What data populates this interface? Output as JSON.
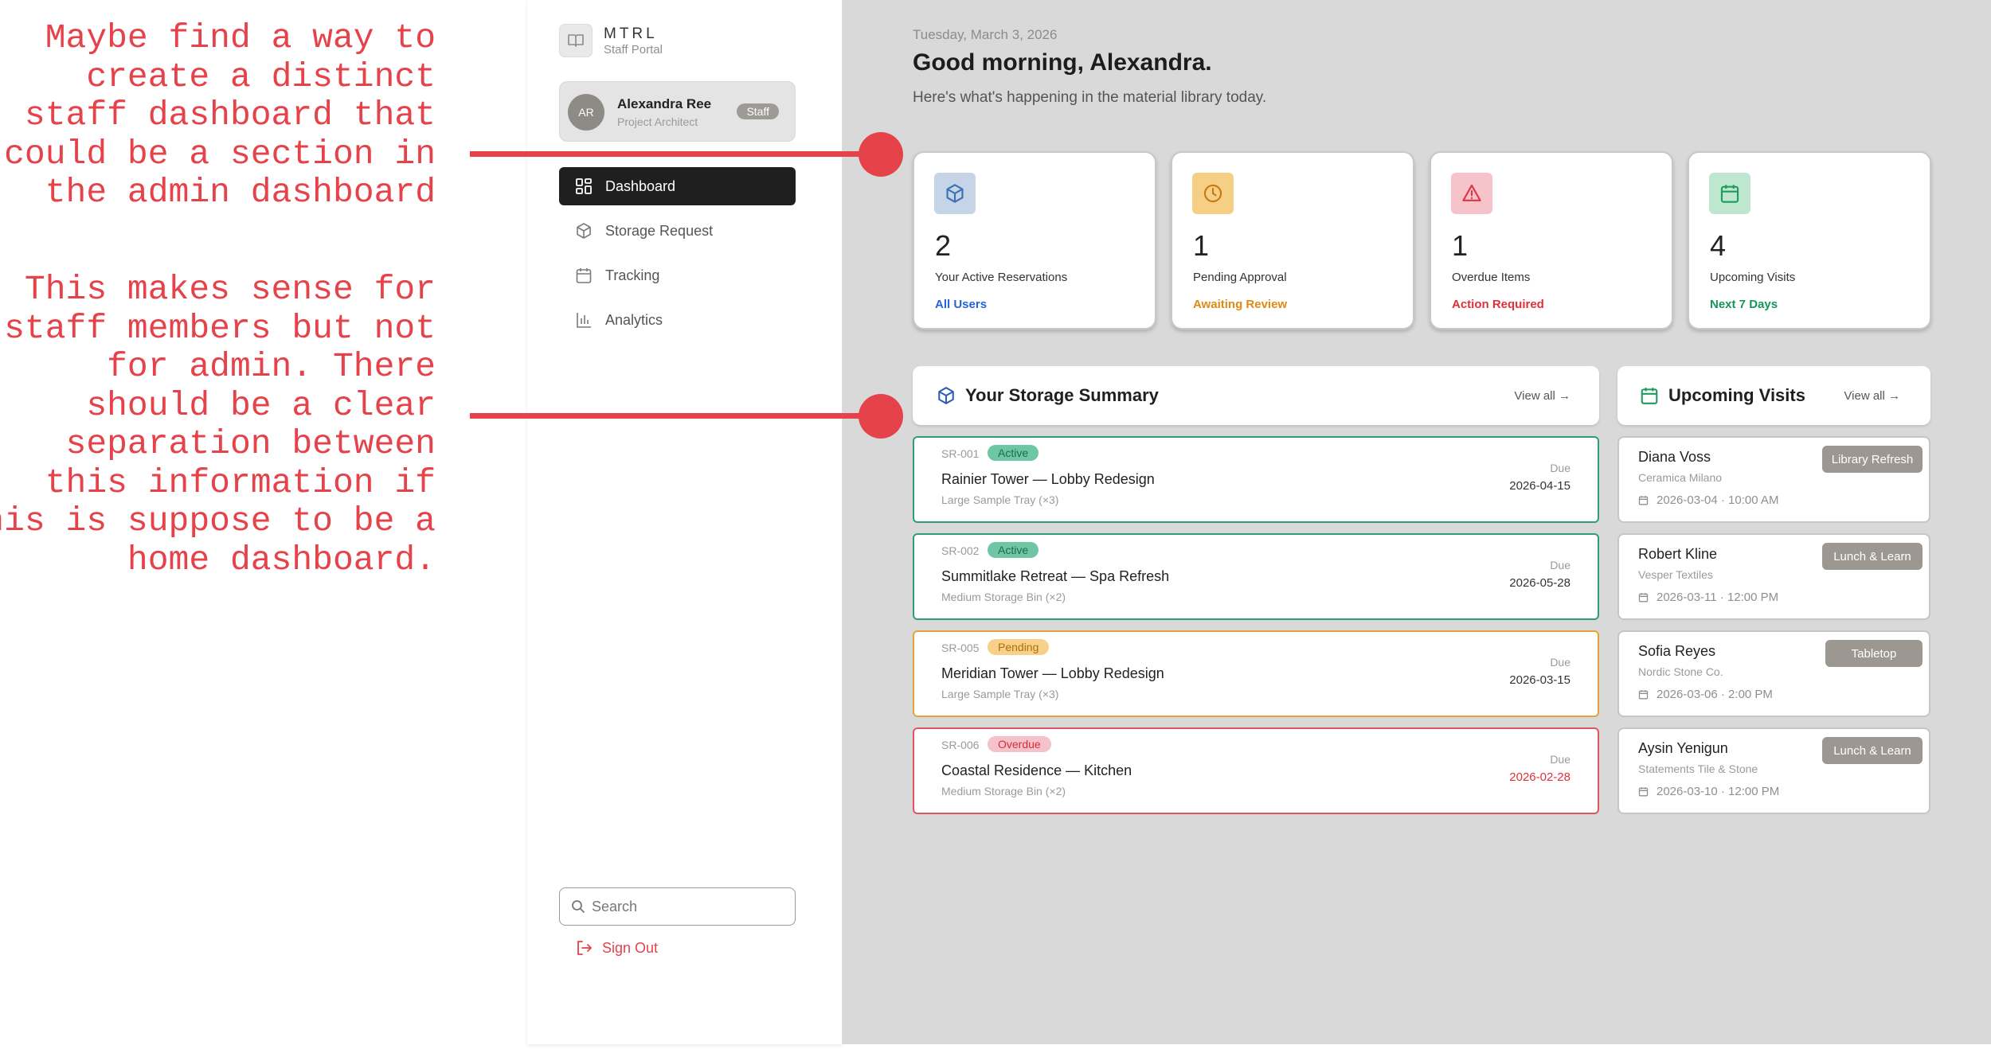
{
  "annotations": [
    {
      "lines": [
        "Maybe find a way to",
        "create a distinct",
        "staff dashboard that",
        "could be a section in",
        "the admin dashboard"
      ]
    },
    {
      "lines": [
        "This makes sense for",
        "staff members but not",
        "for admin. There",
        "should be a clear",
        "separation between",
        "this information if",
        "his is suppose to be a",
        "home dashboard."
      ]
    }
  ],
  "app": {
    "name": "MTRL",
    "subtitle": "Staff Portal"
  },
  "user": {
    "initials": "AR",
    "name": "Alexandra Ree",
    "role": "Project Architect",
    "badge": "Staff"
  },
  "nav": [
    {
      "label": "Dashboard",
      "icon": "grid-icon",
      "active": true
    },
    {
      "label": "Storage Request",
      "icon": "box-icon",
      "active": false
    },
    {
      "label": "Tracking",
      "icon": "calendar-icon",
      "active": false
    },
    {
      "label": "Analytics",
      "icon": "bar-chart-icon",
      "active": false
    }
  ],
  "search": {
    "placeholder": "Search",
    "value": ""
  },
  "sign_out": "Sign Out",
  "header": {
    "date": "Tuesday, March 3, 2026",
    "greeting": "Good morning, Alexandra.",
    "subtitle": "Here's what's happening in the material library today."
  },
  "stats": [
    {
      "value": "2",
      "label": "Your Active Reservations",
      "sub": "All Users",
      "sub_color": "#2563d9",
      "icon": "box-icon",
      "icon_bg": "#c5d4e6",
      "icon_color": "#3d6fb6"
    },
    {
      "value": "1",
      "label": "Pending Approval",
      "sub": "Awaiting Review",
      "sub_color": "#e08a10",
      "icon": "clock-icon",
      "icon_bg": "#f6cf86",
      "icon_color": "#c8790f"
    },
    {
      "value": "1",
      "label": "Overdue Items",
      "sub": "Action Required",
      "sub_color": "#e0303b",
      "icon": "warning-icon",
      "icon_bg": "#f6c3cb",
      "icon_color": "#dc3545"
    },
    {
      "value": "4",
      "label": "Upcoming Visits",
      "sub": "Next 7 Days",
      "sub_color": "#14965a",
      "icon": "calendar-icon",
      "icon_bg": "#bfe6cf",
      "icon_color": "#1f9b5d"
    }
  ],
  "storage": {
    "title": "Your Storage Summary",
    "view_all": "View all →",
    "due_label": "Due",
    "items": [
      {
        "id": "SR-001",
        "status": "Active",
        "title": "Rainier Tower — Lobby Redesign",
        "item": "Large Sample Tray (×3)",
        "due": "2026-04-15",
        "border": "#2f9c7b",
        "status_bg": "#6fc6a5",
        "status_color": "#1d6a50",
        "due_color": "#333333"
      },
      {
        "id": "SR-002",
        "status": "Active",
        "title": "Summitlake Retreat — Spa Refresh",
        "item": "Medium Storage Bin (×2)",
        "due": "2026-05-28",
        "border": "#2f9c7b",
        "status_bg": "#6fc6a5",
        "status_color": "#1d6a50",
        "due_color": "#333333"
      },
      {
        "id": "SR-005",
        "status": "Pending",
        "title": "Meridian Tower — Lobby Redesign",
        "item": "Large Sample Tray (×3)",
        "due": "2026-03-15",
        "border": "#e3a338",
        "status_bg": "#f7d08a",
        "status_color": "#b36d07",
        "due_color": "#333333"
      },
      {
        "id": "SR-006",
        "status": "Overdue",
        "title": "Coastal Residence — Kitchen",
        "item": "Medium Storage Bin (×2)",
        "due": "2026-02-28",
        "border": "#e05560",
        "status_bg": "#f6c2c9",
        "status_color": "#d12f3c",
        "due_color": "#e0303b"
      }
    ]
  },
  "visits": {
    "title": "Upcoming Visits",
    "view_all": "View all →",
    "items": [
      {
        "name": "Diana Voss",
        "company": "Ceramica Milano",
        "when": "2026-03-04 · 10:00 AM",
        "tag": "Library Refresh"
      },
      {
        "name": "Robert Kline",
        "company": "Vesper Textiles",
        "when": "2026-03-11 · 12:00 PM",
        "tag": "Lunch & Learn"
      },
      {
        "name": "Sofia Reyes",
        "company": "Nordic Stone Co.",
        "when": "2026-03-06 · 2:00 PM",
        "tag": "Tabletop"
      },
      {
        "name": "Aysin Yenigun",
        "company": "Statements Tile & Stone",
        "when": "2026-03-10 · 12:00 PM",
        "tag": "Lunch & Learn"
      }
    ]
  }
}
